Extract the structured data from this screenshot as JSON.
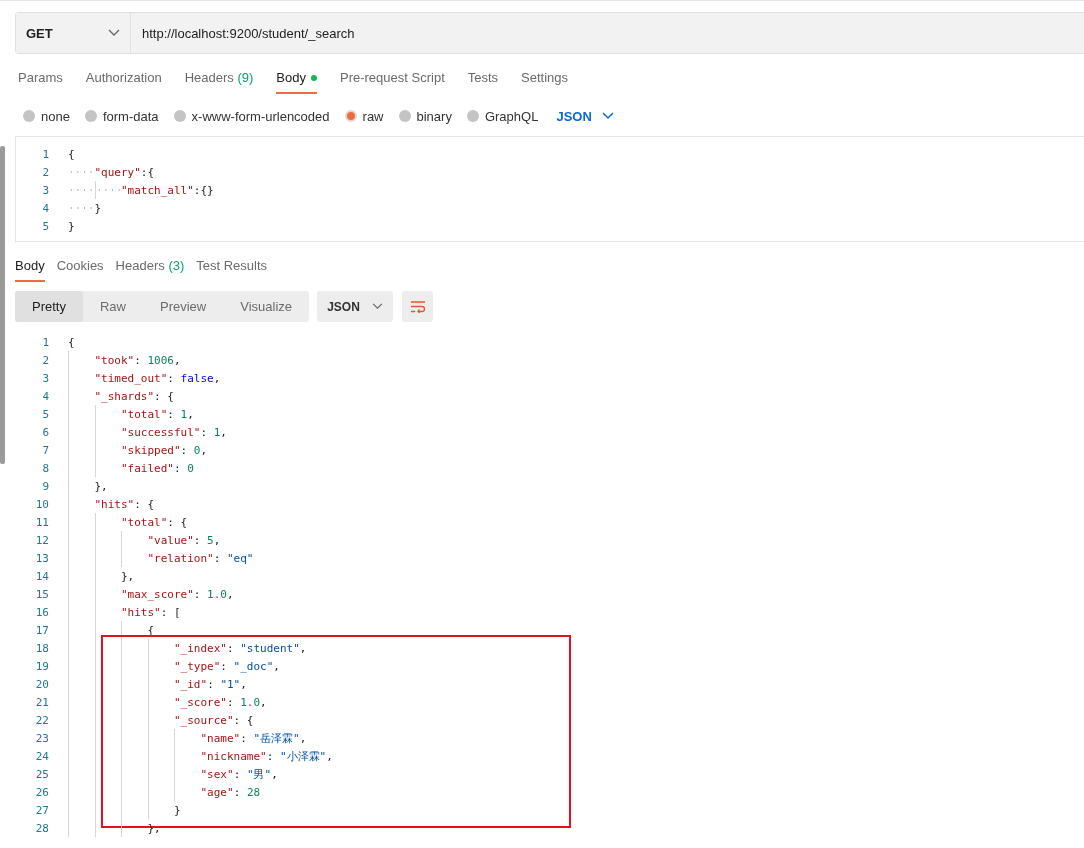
{
  "request": {
    "method": "GET",
    "url": "http://localhost:9200/student/_search"
  },
  "request_tabs": [
    {
      "label": "Params",
      "selected": false
    },
    {
      "label": "Authorization",
      "selected": false
    },
    {
      "label": "Headers",
      "count": "(9)",
      "selected": false
    },
    {
      "label": "Body",
      "selected": true,
      "dot": true
    },
    {
      "label": "Pre-request Script",
      "selected": false
    },
    {
      "label": "Tests",
      "selected": false
    },
    {
      "label": "Settings",
      "selected": false
    }
  ],
  "body_types": [
    {
      "label": "none",
      "selected": false
    },
    {
      "label": "form-data",
      "selected": false
    },
    {
      "label": "x-www-form-urlencoded",
      "selected": false
    },
    {
      "label": "raw",
      "selected": true
    },
    {
      "label": "binary",
      "selected": false
    },
    {
      "label": "GraphQL",
      "selected": false
    }
  ],
  "body_format": "JSON",
  "request_editor": {
    "show_whitespace": true,
    "lines": [
      {
        "n": "1",
        "tk": [
          {
            "text": "{",
            "kind": "p"
          }
        ],
        "children": [
          {
            "n": "2",
            "tk": [
              {
                "text": "\"query\"",
                "kind": "key"
              },
              {
                "text": ":{",
                "kind": "p"
              }
            ],
            "children": [
              {
                "n": "3",
                "tk": [
                  {
                    "text": "\"match_all\"",
                    "kind": "key"
                  },
                  {
                    "text": ":{}",
                    "kind": "p"
                  }
                ]
              }
            ]
          },
          {
            "n": "4",
            "tk": [
              {
                "text": "}",
                "kind": "p"
              }
            ]
          }
        ]
      },
      {
        "n": "5",
        "tk": [
          {
            "text": "}",
            "kind": "p"
          }
        ]
      }
    ]
  },
  "response_tabs": [
    {
      "label": "Body",
      "selected": true
    },
    {
      "label": "Cookies",
      "selected": false
    },
    {
      "label": "Headers",
      "count": "(3)",
      "selected": false
    },
    {
      "label": "Test Results",
      "selected": false
    }
  ],
  "view_modes": [
    {
      "label": "Pretty",
      "selected": true
    },
    {
      "label": "Raw",
      "selected": false
    },
    {
      "label": "Preview",
      "selected": false
    },
    {
      "label": "Visualize",
      "selected": false
    }
  ],
  "response_format": "JSON",
  "response_editor": {
    "lines": [
      {
        "n": "1",
        "tk": [
          {
            "text": "{",
            "kind": "p"
          }
        ],
        "children": [
          {
            "n": "2",
            "tk": [
              {
                "text": "\"took\"",
                "kind": "key"
              },
              {
                "text": ": ",
                "kind": "p"
              },
              {
                "text": "1006",
                "kind": "num"
              },
              {
                "text": ",",
                "kind": "p"
              }
            ]
          },
          {
            "n": "3",
            "tk": [
              {
                "text": "\"timed_out\"",
                "kind": "key"
              },
              {
                "text": ": ",
                "kind": "p"
              },
              {
                "text": "false",
                "kind": "bool"
              },
              {
                "text": ",",
                "kind": "p"
              }
            ]
          },
          {
            "n": "4",
            "tk": [
              {
                "text": "\"_shards\"",
                "kind": "key"
              },
              {
                "text": ": {",
                "kind": "p"
              }
            ],
            "children": [
              {
                "n": "5",
                "tk": [
                  {
                    "text": "\"total\"",
                    "kind": "key"
                  },
                  {
                    "text": ": ",
                    "kind": "p"
                  },
                  {
                    "text": "1",
                    "kind": "num"
                  },
                  {
                    "text": ",",
                    "kind": "p"
                  }
                ]
              },
              {
                "n": "6",
                "tk": [
                  {
                    "text": "\"successful\"",
                    "kind": "key"
                  },
                  {
                    "text": ": ",
                    "kind": "p"
                  },
                  {
                    "text": "1",
                    "kind": "num"
                  },
                  {
                    "text": ",",
                    "kind": "p"
                  }
                ]
              },
              {
                "n": "7",
                "tk": [
                  {
                    "text": "\"skipped\"",
                    "kind": "key"
                  },
                  {
                    "text": ": ",
                    "kind": "p"
                  },
                  {
                    "text": "0",
                    "kind": "num"
                  },
                  {
                    "text": ",",
                    "kind": "p"
                  }
                ]
              },
              {
                "n": "8",
                "tk": [
                  {
                    "text": "\"failed\"",
                    "kind": "key"
                  },
                  {
                    "text": ": ",
                    "kind": "p"
                  },
                  {
                    "text": "0",
                    "kind": "num"
                  }
                ]
              }
            ]
          },
          {
            "n": "9",
            "tk": [
              {
                "text": "},",
                "kind": "p"
              }
            ]
          },
          {
            "n": "10",
            "tk": [
              {
                "text": "\"hits\"",
                "kind": "key"
              },
              {
                "text": ": {",
                "kind": "p"
              }
            ],
            "children": [
              {
                "n": "11",
                "tk": [
                  {
                    "text": "\"total\"",
                    "kind": "key"
                  },
                  {
                    "text": ": {",
                    "kind": "p"
                  }
                ],
                "children": [
                  {
                    "n": "12",
                    "tk": [
                      {
                        "text": "\"value\"",
                        "kind": "key"
                      },
                      {
                        "text": ": ",
                        "kind": "p"
                      },
                      {
                        "text": "5",
                        "kind": "num"
                      },
                      {
                        "text": ",",
                        "kind": "p"
                      }
                    ]
                  },
                  {
                    "n": "13",
                    "tk": [
                      {
                        "text": "\"relation\"",
                        "kind": "key"
                      },
                      {
                        "text": ": ",
                        "kind": "p"
                      },
                      {
                        "text": "\"eq\"",
                        "kind": "str"
                      }
                    ]
                  }
                ]
              },
              {
                "n": "14",
                "tk": [
                  {
                    "text": "},",
                    "kind": "p"
                  }
                ]
              },
              {
                "n": "15",
                "tk": [
                  {
                    "text": "\"max_score\"",
                    "kind": "key"
                  },
                  {
                    "text": ": ",
                    "kind": "p"
                  },
                  {
                    "text": "1.0",
                    "kind": "num"
                  },
                  {
                    "text": ",",
                    "kind": "p"
                  }
                ]
              },
              {
                "n": "16",
                "tk": [
                  {
                    "text": "\"hits\"",
                    "kind": "key"
                  },
                  {
                    "text": ": [",
                    "kind": "p"
                  }
                ],
                "children": [
                  {
                    "n": "17",
                    "tk": [
                      {
                        "text": "{",
                        "kind": "p"
                      }
                    ],
                    "boxed": true,
                    "children": [
                      {
                        "n": "18",
                        "tk": [
                          {
                            "text": "\"_index\"",
                            "kind": "key"
                          },
                          {
                            "text": ": ",
                            "kind": "p"
                          },
                          {
                            "text": "\"student\"",
                            "kind": "str"
                          },
                          {
                            "text": ",",
                            "kind": "p"
                          }
                        ]
                      },
                      {
                        "n": "19",
                        "tk": [
                          {
                            "text": "\"_type\"",
                            "kind": "key"
                          },
                          {
                            "text": ": ",
                            "kind": "p"
                          },
                          {
                            "text": "\"_doc\"",
                            "kind": "str"
                          },
                          {
                            "text": ",",
                            "kind": "p"
                          }
                        ]
                      },
                      {
                        "n": "20",
                        "tk": [
                          {
                            "text": "\"_id\"",
                            "kind": "key"
                          },
                          {
                            "text": ": ",
                            "kind": "p"
                          },
                          {
                            "text": "\"1\"",
                            "kind": "str"
                          },
                          {
                            "text": ",",
                            "kind": "p"
                          }
                        ]
                      },
                      {
                        "n": "21",
                        "tk": [
                          {
                            "text": "\"_score\"",
                            "kind": "key"
                          },
                          {
                            "text": ": ",
                            "kind": "p"
                          },
                          {
                            "text": "1.0",
                            "kind": "num"
                          },
                          {
                            "text": ",",
                            "kind": "p"
                          }
                        ]
                      },
                      {
                        "n": "22",
                        "tk": [
                          {
                            "text": "\"_source\"",
                            "kind": "key"
                          },
                          {
                            "text": ": {",
                            "kind": "p"
                          }
                        ],
                        "children": [
                          {
                            "n": "23",
                            "tk": [
                              {
                                "text": "\"name\"",
                                "kind": "key"
                              },
                              {
                                "text": ": ",
                                "kind": "p"
                              },
                              {
                                "text": "\"岳泽霖\"",
                                "kind": "str"
                              },
                              {
                                "text": ",",
                                "kind": "p"
                              }
                            ]
                          },
                          {
                            "n": "24",
                            "tk": [
                              {
                                "text": "\"nickname\"",
                                "kind": "key"
                              },
                              {
                                "text": ": ",
                                "kind": "p"
                              },
                              {
                                "text": "\"小泽霖\"",
                                "kind": "str"
                              },
                              {
                                "text": ",",
                                "kind": "p"
                              }
                            ]
                          },
                          {
                            "n": "25",
                            "tk": [
                              {
                                "text": "\"sex\"",
                                "kind": "key"
                              },
                              {
                                "text": ": ",
                                "kind": "p"
                              },
                              {
                                "text": "\"男\"",
                                "kind": "str"
                              },
                              {
                                "text": ",",
                                "kind": "p"
                              }
                            ]
                          },
                          {
                            "n": "26",
                            "tk": [
                              {
                                "text": "\"age\"",
                                "kind": "key"
                              },
                              {
                                "text": ": ",
                                "kind": "p"
                              },
                              {
                                "text": "28",
                                "kind": "num"
                              }
                            ]
                          }
                        ]
                      },
                      {
                        "n": "27",
                        "tk": [
                          {
                            "text": "}",
                            "kind": "p"
                          }
                        ]
                      }
                    ]
                  },
                  {
                    "n": "28",
                    "tk": [
                      {
                        "text": "},",
                        "kind": "p"
                      }
                    ]
                  }
                ]
              }
            ]
          }
        ]
      }
    ]
  }
}
